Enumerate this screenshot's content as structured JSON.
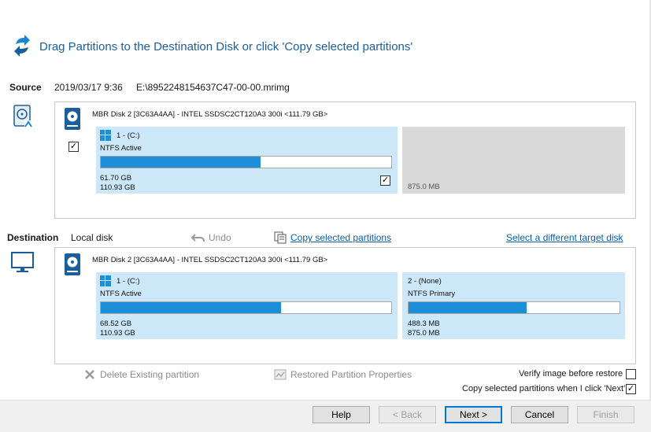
{
  "header": {
    "title": "Drag Partitions to the Destination Disk or click 'Copy selected partitions'",
    "icon": "sync-arrows-icon"
  },
  "source": {
    "label": "Source",
    "date": "2019/03/17 9:36",
    "path": "E:\\8952248154637C47-00-00.mrimg",
    "disk_caption": "MBR Disk 2 [3C63A4AA] - INTEL SSDSC2CT120A3 300i  <111.79 GB>",
    "partitions": [
      {
        "title": "1 -  (C:)",
        "type": "NTFS Active",
        "used": "61.70 GB",
        "total": "110.93 GB",
        "fill": 0.55,
        "checked": true
      },
      {
        "size": "875.0 MB"
      }
    ],
    "disk_checked": true
  },
  "destination": {
    "label": "Destination",
    "type": "Local disk",
    "undo": "Undo",
    "copy_link": "Copy selected partitions",
    "target_link": "Select a different target disk",
    "disk_caption": "MBR Disk 2 [3C63A4AA] - INTEL SSDSC2CT120A3 300i  <111.79 GB>",
    "partitions": [
      {
        "title": "1 -  (C:)",
        "type": "NTFS Active",
        "used": "68.52 GB",
        "total": "110.93 GB",
        "fill": 0.62
      },
      {
        "title": "2 -  (None)",
        "type": "NTFS Primary",
        "used": "488.3 MB",
        "total": "875.0 MB",
        "fill": 0.56
      }
    ]
  },
  "actions": {
    "delete": "Delete Existing partition",
    "restored_props": "Restored Partition Properties",
    "verify": "Verify image before restore",
    "verify_checked": false,
    "copy_on_next": "Copy selected partitions when I click 'Next'",
    "copy_on_next_checked": true
  },
  "buttons": {
    "help": "Help",
    "back": "< Back",
    "next": "Next >",
    "cancel": "Cancel",
    "finish": "Finish"
  },
  "colors": {
    "accent": "#1d8fd8",
    "partition_bg": "#cce7f8",
    "link": "#0b5ea8"
  }
}
